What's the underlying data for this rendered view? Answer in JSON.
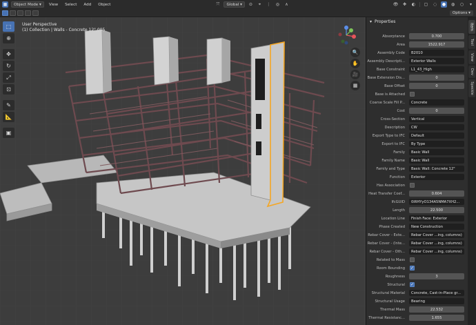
{
  "header": {
    "mode": "Object Mode",
    "menu": [
      "View",
      "Select",
      "Add",
      "Object"
    ],
    "transform_orientation": "Global",
    "options_label": "Options"
  },
  "viewport": {
    "title": "User Perspective",
    "subtitle": "(1) Collection | Walls - Concrete 12\".005"
  },
  "tools": [
    "cursor-select",
    "cursor",
    "move",
    "rotate",
    "scale",
    "transform",
    "annotate",
    "measure",
    "add-cube"
  ],
  "panel": {
    "title": "Properties",
    "tabs": [
      "Item",
      "Tool",
      "View",
      "Dev",
      "Speckle"
    ],
    "rows": [
      {
        "label": "Absorptance",
        "value": "0.700",
        "kind": "num"
      },
      {
        "label": "Area",
        "value": "1522.917",
        "kind": "num"
      },
      {
        "label": "Assembly Code",
        "value": "B2010",
        "kind": "text"
      },
      {
        "label": "Assembly Descripti...",
        "value": "Exterior Walls",
        "kind": "text"
      },
      {
        "label": "Base Constraint",
        "value": "L1_43_High",
        "kind": "text"
      },
      {
        "label": "Base Extension Dis...",
        "value": "0",
        "kind": "num"
      },
      {
        "label": "Base Offset",
        "value": "0",
        "kind": "num"
      },
      {
        "label": "Base is Attached",
        "value": "",
        "kind": "check",
        "checked": false
      },
      {
        "label": "Coarse Scale Fill P...",
        "value": "Concrete",
        "kind": "text"
      },
      {
        "label": "Cost",
        "value": "0",
        "kind": "num"
      },
      {
        "label": "Cross-Section",
        "value": "Vertical",
        "kind": "text"
      },
      {
        "label": "Description",
        "value": "CW",
        "kind": "text"
      },
      {
        "label": "Export Type to IFC",
        "value": "Default",
        "kind": "text"
      },
      {
        "label": "Export to IFC",
        "value": "By Type",
        "kind": "text"
      },
      {
        "label": "Family",
        "value": "Basic Wall",
        "kind": "text"
      },
      {
        "label": "Family Name",
        "value": "Basic Wall",
        "kind": "text"
      },
      {
        "label": "Family and Type",
        "value": "Basic Wall: Concrete 12\"",
        "kind": "text"
      },
      {
        "label": "Function",
        "value": "Exterior",
        "kind": "text"
      },
      {
        "label": "Has Association",
        "value": "",
        "kind": "check",
        "checked": false
      },
      {
        "label": "Heat Transfer Coef...",
        "value": "0.604",
        "kind": "num"
      },
      {
        "label": "IfcGUID",
        "value": "0iRHYyO134A5NMA7XH2...",
        "kind": "text"
      },
      {
        "label": "Length",
        "value": "22.500",
        "kind": "num"
      },
      {
        "label": "Location Line",
        "value": "Finish Face: Exterior",
        "kind": "text"
      },
      {
        "label": "Phase Created",
        "value": "New Construction",
        "kind": "text"
      },
      {
        "label": "Rebar Cover - Exte...",
        "value": "Rebar Cover ...ing, columns)",
        "kind": "text"
      },
      {
        "label": "Rebar Cover - (Inte...",
        "value": "Rebar Cover ...ing, columns)",
        "kind": "text"
      },
      {
        "label": "Rebar Cover - Oth...",
        "value": "Rebar Cover ...ing, columns)",
        "kind": "text"
      },
      {
        "label": "Related to Mass",
        "value": "",
        "kind": "check",
        "checked": false
      },
      {
        "label": "Room Bounding",
        "value": "",
        "kind": "check",
        "checked": true
      },
      {
        "label": "Roughness",
        "value": "3",
        "kind": "num"
      },
      {
        "label": "Structural",
        "value": "",
        "kind": "check",
        "checked": true
      },
      {
        "label": "Structural Material",
        "value": "Concrete, Cast-in-Place gr...",
        "kind": "text"
      },
      {
        "label": "Structural Usage",
        "value": "Bearing",
        "kind": "text"
      },
      {
        "label": "Thermal Mass",
        "value": "22.532",
        "kind": "num"
      },
      {
        "label": "Thermal Resistanc...",
        "value": "1.655",
        "kind": "num"
      }
    ]
  },
  "colors": {
    "accent": "#4772b3",
    "selection": "#f5a623",
    "steel": "#6e4a4f",
    "concrete": "#b4b4b4"
  }
}
